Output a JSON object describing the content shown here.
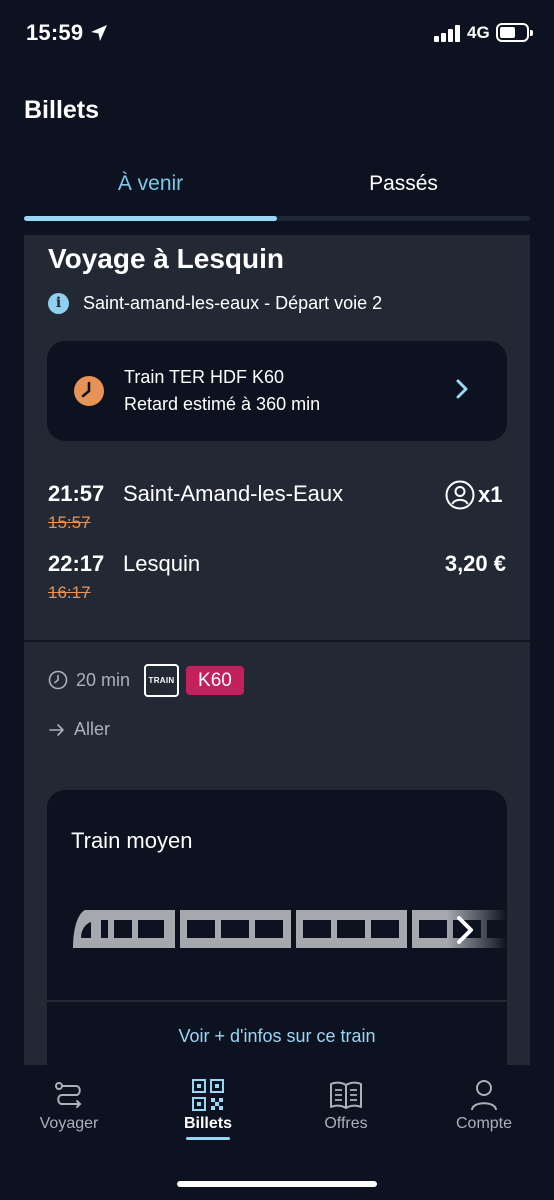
{
  "status_bar": {
    "time": "15:59",
    "network": "4G"
  },
  "header": {
    "title": "Billets"
  },
  "tabs": [
    {
      "label": "À venir",
      "active": true
    },
    {
      "label": "Passés",
      "active": false
    }
  ],
  "trip": {
    "title": "Voyage à Lesquin",
    "info": "Saint-amand-les-eaux - Départ voie 2",
    "delay": {
      "line1": "Train TER HDF K60",
      "line2": "Retard estimé à 360 min"
    },
    "departure": {
      "time": "21:57",
      "original_time": "15:57",
      "station": "Saint-Amand-les-Eaux"
    },
    "arrival": {
      "time": "22:17",
      "original_time": "16:17",
      "station": "Lesquin"
    },
    "passengers": "x1",
    "price": "3,20 €",
    "duration": "20 min",
    "train_badge": "TRAIN",
    "line": "K60",
    "direction": "Aller",
    "train_card": {
      "label": "Train moyen",
      "link": "Voir + d'infos sur ce train"
    }
  },
  "bottom_nav": [
    {
      "label": "Voyager",
      "icon": "route-icon",
      "active": false
    },
    {
      "label": "Billets",
      "icon": "qr-code-icon",
      "active": true
    },
    {
      "label": "Offres",
      "icon": "book-icon",
      "active": false
    },
    {
      "label": "Compte",
      "icon": "person-icon",
      "active": false
    }
  ],
  "colors": {
    "background": "#0c1220",
    "card": "#222935",
    "accent": "#9ad7f4",
    "delay_orange": "#e79357",
    "line_badge": "#c4215c"
  }
}
